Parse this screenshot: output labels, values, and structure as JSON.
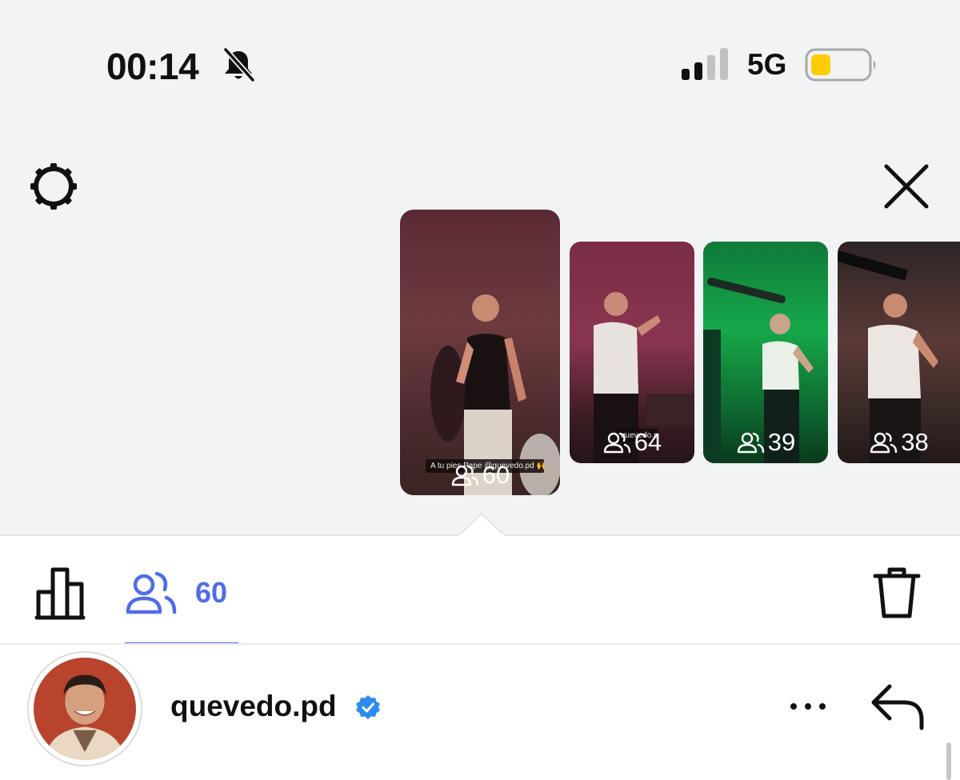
{
  "status_bar": {
    "time": "00:14",
    "network": "5G",
    "battery_color": "#ffcc00",
    "icons": [
      "bell-slash-icon",
      "signal-icon",
      "battery-icon"
    ]
  },
  "header": {
    "settings_icon": "gear-icon",
    "close_icon": "close-icon"
  },
  "thumbnails": [
    {
      "viewers": "60",
      "caption": "A tu pies Pape @quevedo.pd 🙌😍",
      "selected": true
    },
    {
      "viewers": "64",
      "caption": "quevedo.pd"
    },
    {
      "viewers": "39"
    },
    {
      "viewers": "38"
    }
  ],
  "tabs": {
    "stats_icon": "bar-chart-icon",
    "viewers_icon": "viewers-icon",
    "viewers_count": "60",
    "delete_icon": "trash-icon",
    "accent_color": "#4f6ce8"
  },
  "viewer_row": {
    "username": "quevedo.pd",
    "verified": true,
    "more_icon": "more-icon",
    "reply_icon": "reply-icon"
  }
}
